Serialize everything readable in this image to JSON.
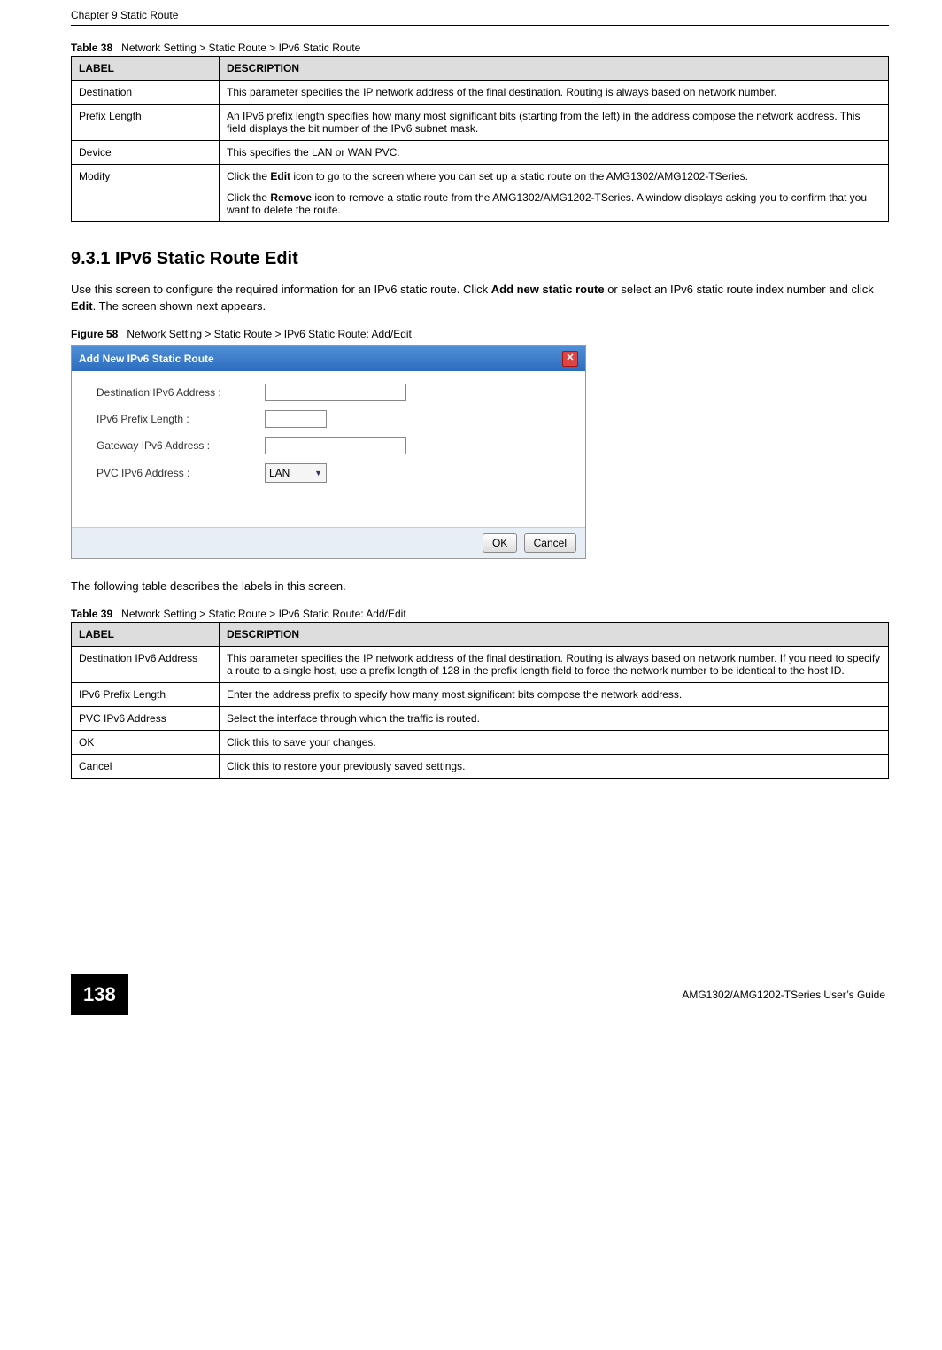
{
  "running_header": "Chapter 9 Static Route",
  "table38": {
    "caption_num": "Table 38",
    "caption_text": "Network Setting > Static Route > IPv6 Static Route",
    "head_label": "LABEL",
    "head_desc": "DESCRIPTION",
    "rows": [
      {
        "label": "Destination",
        "desc": "This parameter specifies the IP network address of the final destination. Routing is always based on network number."
      },
      {
        "label": "Prefix Length",
        "desc": "An IPv6 prefix length specifies how many most significant bits (starting from the left) in the address compose the network address. This field displays the bit number of the IPv6 subnet mask."
      },
      {
        "label": "Device",
        "desc": "This specifies the LAN or WAN PVC."
      },
      {
        "label": "Modify",
        "desc_p1_a": "Click the ",
        "desc_p1_b": "Edit",
        "desc_p1_c": " icon to go to the screen where you can set up a static route on the AMG1302/AMG1202-TSeries.",
        "desc_p2_a": "Click the ",
        "desc_p2_b": "Remove",
        "desc_p2_c": " icon to remove a static route from the AMG1302/AMG1202-TSeries. A window displays asking you to confirm that you want to delete the route."
      }
    ]
  },
  "section": {
    "heading": "9.3.1  IPv6 Static Route Edit",
    "intro_a": "Use this screen to configure the required information for an IPv6 static route. Click ",
    "intro_b": "Add new static route",
    "intro_c": " or select an IPv6 static route index number and click ",
    "intro_d": "Edit",
    "intro_e": ". The screen shown next appears."
  },
  "figure58": {
    "caption_num": "Figure 58",
    "caption_text": "Network Setting > Static Route > IPv6 Static Route: Add/Edit",
    "dialog_title": "Add New IPv6 Static Route",
    "close_glyph": "✕",
    "fields": {
      "dest_label": "Destination IPv6 Address :",
      "prefix_label": "IPv6 Prefix Length :",
      "gateway_label": "Gateway IPv6 Address :",
      "pvc_label": "PVC IPv6 Address :",
      "pvc_value": "LAN"
    },
    "ok": "OK",
    "cancel": "Cancel"
  },
  "after_figure": "The following table describes the labels in this screen.",
  "table39": {
    "caption_num": "Table 39",
    "caption_text": "Network Setting > Static Route > IPv6 Static Route: Add/Edit",
    "head_label": "LABEL",
    "head_desc": "DESCRIPTION",
    "rows": [
      {
        "label": "Destination IPv6 Address",
        "desc": "This parameter specifies the IP network address of the final destination. Routing is always based on network number. If you need to specify a route to a single host, use a prefix length of 128 in the prefix length field to force the network number to be identical to the host ID."
      },
      {
        "label": "IPv6 Prefix Length",
        "desc": "Enter the address prefix to specify how many most significant bits compose the network address."
      },
      {
        "label": "PVC IPv6 Address",
        "desc": "Select the interface through which the traffic is routed."
      },
      {
        "label": "OK",
        "desc": "Click this to save your changes."
      },
      {
        "label": "Cancel",
        "desc": "Click this to restore your previously saved settings."
      }
    ]
  },
  "footer": {
    "page_number": "138",
    "guide": "AMG1302/AMG1202-TSeries User’s Guide"
  }
}
